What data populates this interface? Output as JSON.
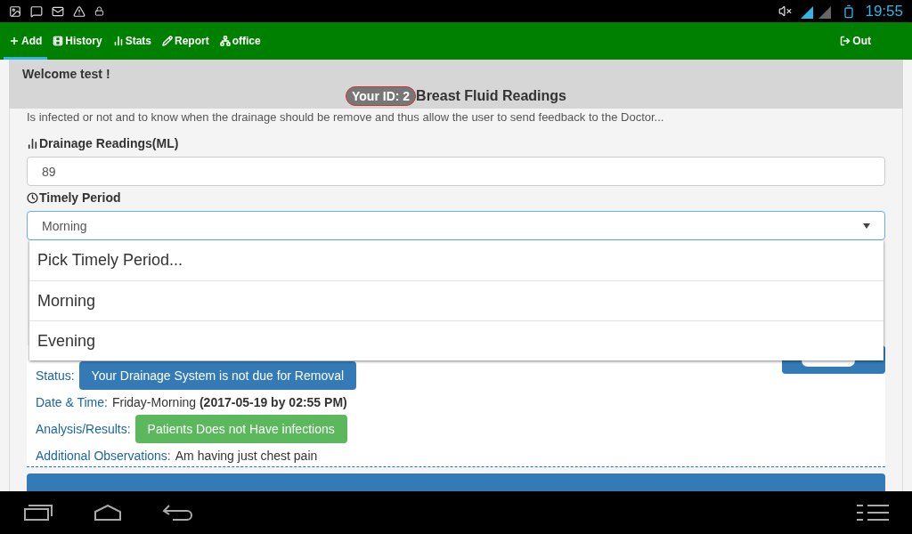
{
  "status_bar": {
    "time": "19:55"
  },
  "nav": {
    "items": [
      {
        "label": "Add",
        "selected": true
      },
      {
        "label": "History",
        "selected": false
      },
      {
        "label": "Stats",
        "selected": false
      },
      {
        "label": "Report",
        "selected": false
      },
      {
        "label": "office",
        "selected": false
      }
    ],
    "logout": "Out"
  },
  "header": {
    "welcome": "Welcome test !",
    "id_badge": "Your ID: 2",
    "title": "Breast Fluid Readings"
  },
  "intro": "Is infected or not and to know when the drainage should be remove and thus allow the user to send feedback to the Doctor...",
  "form": {
    "drainage_label": "Drainage Readings(ML)",
    "drainage_value": "89",
    "period_label": "Timely Period",
    "period_value": "Morning",
    "dropdown": {
      "expanded": true,
      "options": [
        {
          "label": "Pick Timely Period..."
        },
        {
          "label": "Morning"
        },
        {
          "label": "Evening"
        }
      ]
    }
  },
  "record": {
    "status_label": "Status:",
    "status": "Your Drainage System is not due for Removal",
    "date_label": "Date & Time:",
    "date_value": "Friday-Morning",
    "date_detail": "(2017-05-19 by 02:55 PM)",
    "analysis_label": "Analysis/Results:",
    "analysis": "Patients Does not Have infections",
    "observations_label": "Additional Observations:",
    "observations": "Am having just chest pain"
  }
}
